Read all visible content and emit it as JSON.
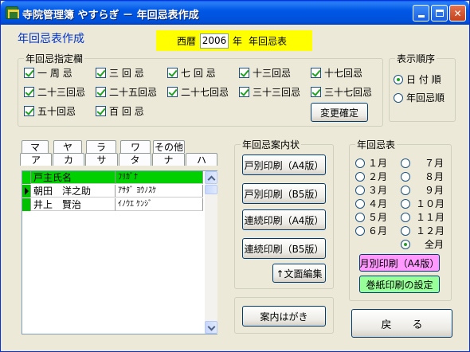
{
  "window": {
    "title": "寺院管理簿 やすらぎ － 年回忌表作成"
  },
  "header": {
    "page_title": "年回忌表作成",
    "era_label": "西暦",
    "year_value": "2006",
    "year_suffix": "年",
    "table_label": "年回忌表"
  },
  "designation": {
    "legend": "年回忌指定欄",
    "items": [
      {
        "label": "一 周 忌",
        "checked": true
      },
      {
        "label": "三 回 忌",
        "checked": true
      },
      {
        "label": "七 回 忌",
        "checked": true
      },
      {
        "label": "十三回忌",
        "checked": true
      },
      {
        "label": "十七回忌",
        "checked": true
      },
      {
        "label": "二十三回忌",
        "checked": true
      },
      {
        "label": "二十五回忌",
        "checked": true
      },
      {
        "label": "二十七回忌",
        "checked": true
      },
      {
        "label": "三十三回忌",
        "checked": true
      },
      {
        "label": "三十七回忌",
        "checked": true
      },
      {
        "label": "五十回忌",
        "checked": true
      },
      {
        "label": "百 回 忌",
        "checked": true
      }
    ],
    "confirm_button": "変更確定"
  },
  "display_order": {
    "legend": "表示順序",
    "options": [
      {
        "label": "日 付 順",
        "selected": true
      },
      {
        "label": "年回忌順",
        "selected": false
      }
    ]
  },
  "kana_tabs": {
    "row1": [
      "マ",
      "ヤ",
      "ラ",
      "ワ",
      "その他"
    ],
    "row2": [
      "ア",
      "カ",
      "サ",
      "タ",
      "ナ",
      "ハ"
    ]
  },
  "grid": {
    "columns": [
      "戸主氏名",
      "ﾌﾘｶﾞﾅ"
    ],
    "rows": [
      {
        "name": "朝田　洋之助",
        "kana": "ｱｻﾀﾞ ﾖｳﾉｽｹ"
      },
      {
        "name": "井上　賢治",
        "kana": "ｲﾉｳｴ ｹﾝｼﾞ"
      }
    ]
  },
  "guide_letter": {
    "legend": "年回忌案内状",
    "buttons": [
      "戸別印刷（A4版）",
      "戸別印刷（B5版）",
      "連続印刷（A4版）",
      "連続印刷（B5版）"
    ],
    "edit_button": "↑文面編集",
    "postcard_button": "案内はがき"
  },
  "table_print": {
    "legend": "年回忌表",
    "months": [
      {
        "label": "１月",
        "selected": false
      },
      {
        "label": "２月",
        "selected": false
      },
      {
        "label": "３月",
        "selected": false
      },
      {
        "label": "４月",
        "selected": false
      },
      {
        "label": "５月",
        "selected": false
      },
      {
        "label": "６月",
        "selected": false
      },
      {
        "label": "７月",
        "selected": false
      },
      {
        "label": "８月",
        "selected": false
      },
      {
        "label": "９月",
        "selected": false
      },
      {
        "label": "１０月",
        "selected": false
      },
      {
        "label": "１１月",
        "selected": false
      },
      {
        "label": "１２月",
        "selected": false
      },
      {
        "label": "全月",
        "selected": true
      }
    ],
    "monthly_print_button": "月別印刷（A4版）",
    "roll_settings_button": "巻紙印刷の設定"
  },
  "back_button": "戻　　る",
  "colors": {
    "title_blue": "#0033cc",
    "year_banner": "#ffff00",
    "grid_header": "#00d000",
    "pink_button": "#ff99ff",
    "green_button": "#99ff99"
  }
}
